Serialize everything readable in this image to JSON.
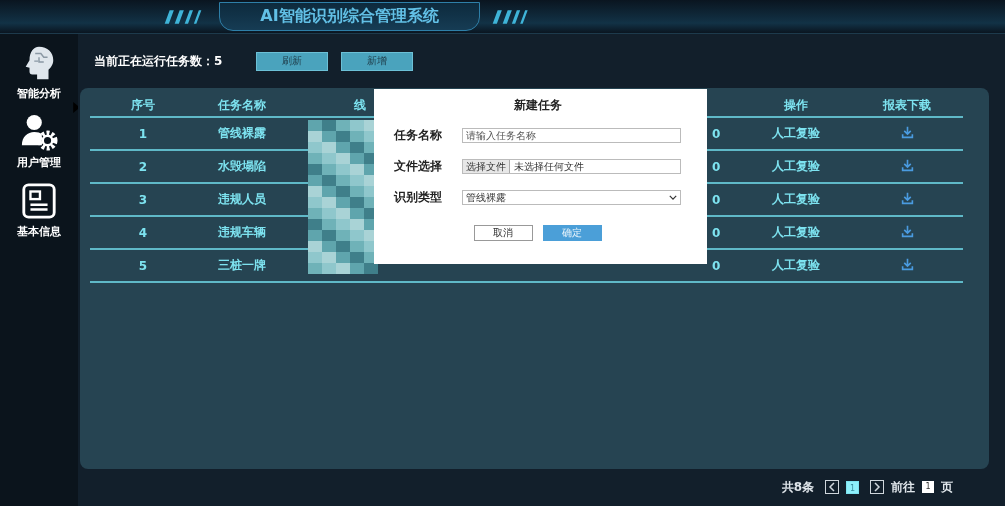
{
  "header": {
    "title": "AI智能识别综合管理系统"
  },
  "sidebar": {
    "items": [
      {
        "label": "智能分析",
        "selected": true
      },
      {
        "label": "用户管理",
        "selected": false
      },
      {
        "label": "基本信息",
        "selected": false
      }
    ]
  },
  "toolbar": {
    "running_label": "当前正在运行任务数：5",
    "buttons": [
      "刷新",
      "新增"
    ]
  },
  "table": {
    "columns": [
      "序号",
      "任务名称",
      "线",
      "",
      "操作",
      "报表下载"
    ],
    "rows": [
      {
        "cells": [
          "1",
          "管线裸露",
          "",
          "0",
          "人工复验"
        ]
      },
      {
        "cells": [
          "2",
          "水毁塌陷",
          "",
          "0",
          "人工复验"
        ]
      },
      {
        "cells": [
          "3",
          "违规人员",
          "",
          "0",
          "人工复验"
        ]
      },
      {
        "cells": [
          "4",
          "违规车辆",
          "",
          "0",
          "人工复验"
        ]
      },
      {
        "cells": [
          "5",
          "三桩一牌",
          "",
          "0",
          "人工复验"
        ]
      }
    ]
  },
  "pagination": {
    "total": "共8条",
    "pages": [
      {
        "label": "1",
        "selected": true
      }
    ],
    "goto_label": "前往",
    "goto_value": "1",
    "page_suffix": "页"
  },
  "dialog": {
    "title": "新建任务",
    "fields": [
      {
        "kind": "text",
        "label": "任务名称",
        "placeholder": "请输入任务名称"
      },
      {
        "kind": "file",
        "label": "文件选择",
        "button": "选择文件",
        "value": "未选择任何文件"
      },
      {
        "kind": "select",
        "label": "识别类型",
        "value": "管线裸露"
      }
    ],
    "buttons": [
      {
        "label": "取消",
        "kind": "secondary"
      },
      {
        "label": "确定",
        "kind": "primary"
      }
    ]
  }
}
